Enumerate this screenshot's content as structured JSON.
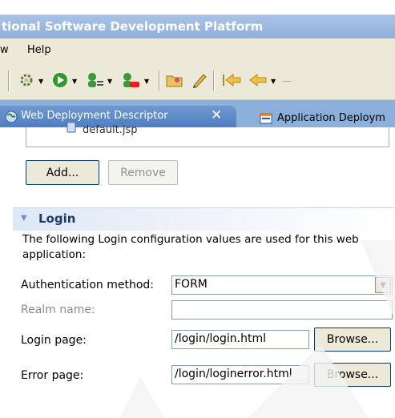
{
  "window": {
    "title": "tional Software Development Platform"
  },
  "menu": {
    "items": [
      "w",
      "Help"
    ]
  },
  "toolbar": {
    "icons": [
      "settings-gear-icon",
      "run-icon",
      "debug-user-icon",
      "server-icon",
      "open-folder-icon",
      "pencil-icon",
      "back-nav-icon",
      "back-arrow-icon"
    ]
  },
  "tabs": {
    "active": "Web Deployment Descriptor",
    "inactive": "Application Deploym"
  },
  "list": {
    "partial_entry": "default.jsp"
  },
  "buttons": {
    "add": "Add...",
    "remove": "Remove"
  },
  "login_section": {
    "title": "Login",
    "description": "The following Login configuration values are used for this web application:",
    "auth_label": "Authentication method:",
    "auth_value": "FORM",
    "realm_label": "Realm name:",
    "realm_value": "",
    "login_label": "Login page:",
    "login_value": "/login/login.html",
    "error_label": "Error page:",
    "error_value": "/login/loginerror.html",
    "browse": "Browse..."
  },
  "colors": {
    "title_bar": "#8eaedb",
    "tab_active": "#4f7fc2",
    "section_title": "#1c3a6c",
    "chrome": "#ece9d8"
  }
}
